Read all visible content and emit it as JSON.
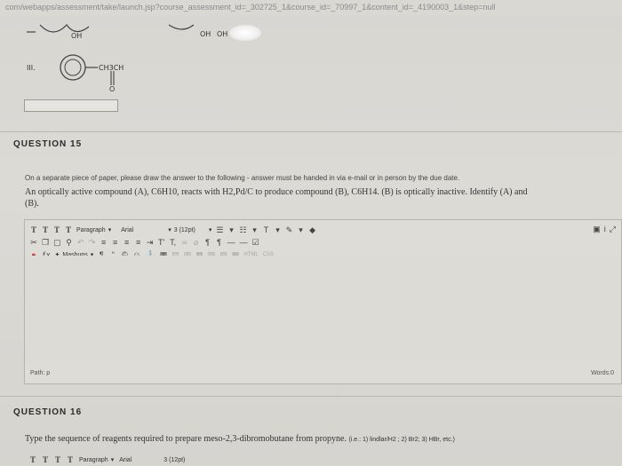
{
  "browser": {
    "url": "com/webapps/assessment/take/launch.jsp?course_assessment_id=_302725_1&course_id=_70997_1&content_id=_4190003_1&step=null"
  },
  "chem_fragment": {
    "roman_label": "III.",
    "labels": [
      "OH",
      "OH",
      "OH",
      "CH3CH",
      "O"
    ]
  },
  "q15": {
    "title": "QUESTION 15",
    "instruction": "On a separate piece of paper, please draw the answer to the following - answer must be handed in via e-mail or in person by the due date.",
    "text_line1": "An optically active compound (A), C6H10, reacts with H2,Pd/C to produce compound (B), C6H14. (B) is optically inactive. Identify (A) and",
    "text_line2": "(B)."
  },
  "editor": {
    "format_block": "Paragraph",
    "font_family": "Arial",
    "font_size": "3 (12pt)",
    "mashups": "Mashups",
    "html_label": "HTML",
    "css_label": "CSS",
    "path_label": "Path: p",
    "words_label": "Words:0"
  },
  "q16": {
    "title": "QUESTION 16",
    "text": "Type the sequence of reagents required to prepare meso-2,3-dibromobutane from propyne.",
    "hint": "(i.e.: 1) lindlar/H2 ; 2) Br2; 3) HBr, etc.)"
  },
  "q16_editor": {
    "format_block": "Paragraph",
    "font_family": "Arial",
    "font_size": "3 (12pt)"
  }
}
